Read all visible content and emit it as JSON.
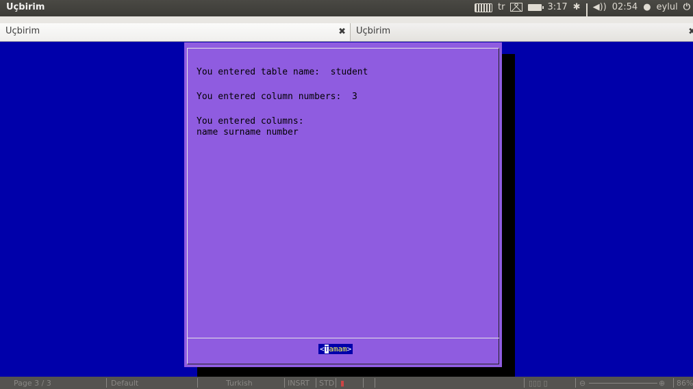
{
  "top_panel": {
    "app_title": "Uçbirim",
    "keyboard_layout": "tr",
    "battery_time": "3:17",
    "clock": "02:54",
    "user": "eylul",
    "icons": [
      "keyboard-icon",
      "mail-icon",
      "battery-icon",
      "bluetooth-icon",
      "network-signal-icon",
      "volume-icon",
      "user-icon",
      "power-icon"
    ]
  },
  "tabs": [
    {
      "label": "Uçbirim",
      "close": "✖"
    },
    {
      "label": "Uçbirim",
      "close": "✖"
    }
  ],
  "dialog": {
    "line1": "You entered table name:  student",
    "line2": "You entered column numbers:  3",
    "line3": "You entered columns:",
    "line4": "name surname number",
    "ok_open": "<",
    "ok_hotkey": "T",
    "ok_rest": "amam",
    "ok_close": ">"
  },
  "status_bar": {
    "page": "Page 3 / 3",
    "style": "Default",
    "language": "Turkish",
    "insert_mode": "INSRT",
    "selection_mode": "STD",
    "zoom": "86%"
  },
  "colors": {
    "terminal_bg": "#0000aa",
    "dialog_bg": "#8f5ce0",
    "panel_bg": "#3c3b37"
  }
}
